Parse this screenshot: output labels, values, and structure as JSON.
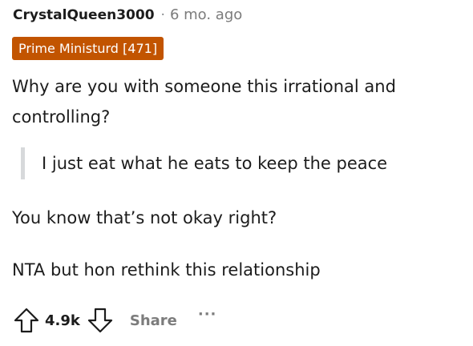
{
  "comment": {
    "author": "CrystalQueen3000",
    "separator": "·",
    "age": "6 mo. ago",
    "flair": "Prime Ministurd [471]",
    "paragraphs": [
      "Why are you with someone this irrational and controlling?",
      "You know that’s not okay right?",
      "NTA but hon rethink this relationship"
    ],
    "quote": "I just eat what he eats to keep the peace"
  },
  "actions": {
    "score": "4.9k",
    "share_label": "Share",
    "more_label": "···"
  },
  "colors": {
    "flair_bg": "#c25400",
    "muted_text": "#7c7c7c",
    "quote_bar": "#d7d9db"
  },
  "icons": {
    "upvote": "upvote-arrow-icon",
    "downvote": "downvote-arrow-icon"
  }
}
